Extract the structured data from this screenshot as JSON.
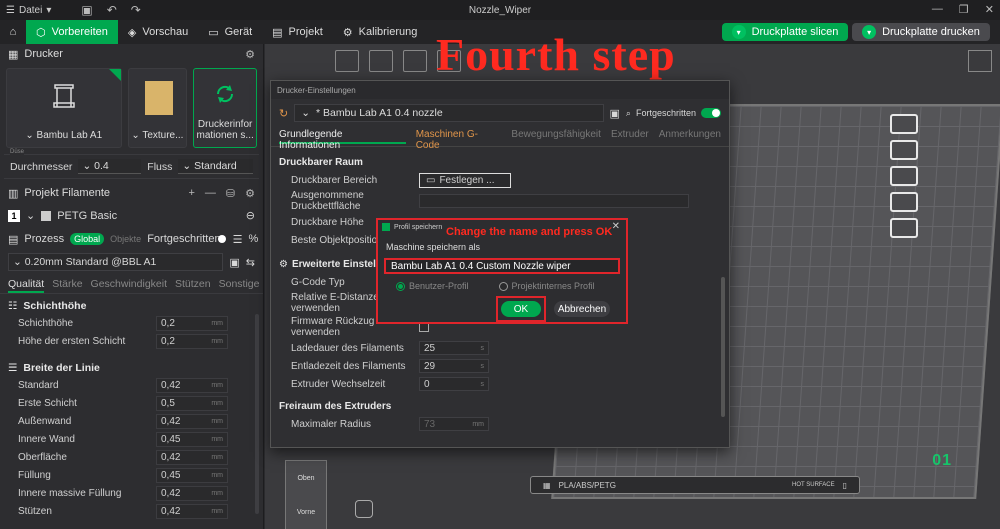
{
  "window": {
    "title": "Nozzle_Wiper",
    "file_menu": "Datei"
  },
  "toolbar": {
    "tabs": [
      "Vorbereiten",
      "Vorschau",
      "Gerät",
      "Projekt",
      "Kalibrierung"
    ],
    "slice_label": "Druckplatte slicen",
    "print_label": "Druckplatte drucken"
  },
  "annotation": {
    "step": "Fourth step",
    "hint": "Change the name and press OK"
  },
  "left": {
    "printer_header": "Drucker",
    "printer_name": "Bambu Lab A1",
    "texture_label": "Texture...",
    "printer_info_label": "Druckerinfor mationen s...",
    "nozzle_tag": "Düse",
    "diameter_label": "Durchmesser",
    "diameter_value": "0.4",
    "flow_label": "Fluss",
    "flow_value": "Standard",
    "filament_header": "Projekt Filamente",
    "filament_slot": "1",
    "filament_name": "PETG Basic",
    "process_label": "Prozess",
    "global_label": "Global",
    "objects_label": "Objekte",
    "advanced_label": "Fortgeschritten",
    "process_preset": "0.20mm Standard @BBL A1",
    "quality_tabs": [
      "Qualität",
      "Stärke",
      "Geschwindigkeit",
      "Stützen",
      "Sonstige"
    ],
    "group_layer": "Schichthöhe",
    "layer_rows": [
      {
        "label": "Schichthöhe",
        "value": "0,2",
        "unit": "mm"
      },
      {
        "label": "Höhe der ersten Schicht",
        "value": "0,2",
        "unit": "mm"
      }
    ],
    "group_width": "Breite der Linie",
    "width_rows": [
      {
        "label": "Standard",
        "value": "0,42",
        "unit": "mm"
      },
      {
        "label": "Erste Schicht",
        "value": "0,5",
        "unit": "mm"
      },
      {
        "label": "Außenwand",
        "value": "0,42",
        "unit": "mm"
      },
      {
        "label": "Innere Wand",
        "value": "0,45",
        "unit": "mm"
      },
      {
        "label": "Oberfläche",
        "value": "0,42",
        "unit": "mm"
      },
      {
        "label": "Füllung",
        "value": "0,45",
        "unit": "mm"
      },
      {
        "label": "Innere massive Füllung",
        "value": "0,42",
        "unit": "mm"
      },
      {
        "label": "Stützen",
        "value": "0,42",
        "unit": "mm"
      }
    ]
  },
  "printer_settings": {
    "title": "Drucker-Einstellungen",
    "preset": "* Bambu Lab A1 0.4 nozzle",
    "advanced_label": "Fortgeschritten",
    "tabs": [
      "Grundlegende Informationen",
      "Maschinen G-Code",
      "Bewegungsfähigkeit",
      "Extruder",
      "Anmerkungen"
    ],
    "sec_printable": "Druckbarer Raum",
    "printable_area_label": "Druckbarer Bereich",
    "printable_area_btn": "Festlegen ...",
    "excluded_label": "Ausgenommene Druckbettfläche",
    "height_label": "Druckbare Höhe",
    "best_pos_label": "Beste Objektposition",
    "sec_extended": "Erweiterte Einstellungen",
    "gcode_type_label": "G-Code Typ",
    "rel_e_label": "Relative E-Distanzen verwenden",
    "fw_retract_label": "Firmware Rückzug verwenden",
    "load_time_label": "Ladedauer des Filaments",
    "load_time_value": "25",
    "unload_time_label": "Entladezeit des Filaments",
    "unload_time_value": "29",
    "change_time_label": "Extruder Wechselzeit",
    "change_time_value": "0",
    "time_unit": "s",
    "sec_clearance": "Freiraum des Extruders",
    "radius_label": "Maximaler Radius",
    "radius_value": "73",
    "radius_unit": "mm"
  },
  "save_dialog": {
    "title": "Profil speichern",
    "label": "Maschine speichern als",
    "name_value": "Bambu Lab A1 0.4 Custom Nozzle wiper",
    "radio_user": "Benutzer-Profil",
    "radio_project": "Projektinternes Profil",
    "ok_label": "OK",
    "cancel_label": "Abbrechen"
  },
  "viewport": {
    "plate_number": "01",
    "plate_bar_text": "PLA/ABS/PETG",
    "hot_surface": "HOT SURFACE",
    "cube_top": "Oben",
    "cube_front": "Vorne"
  }
}
